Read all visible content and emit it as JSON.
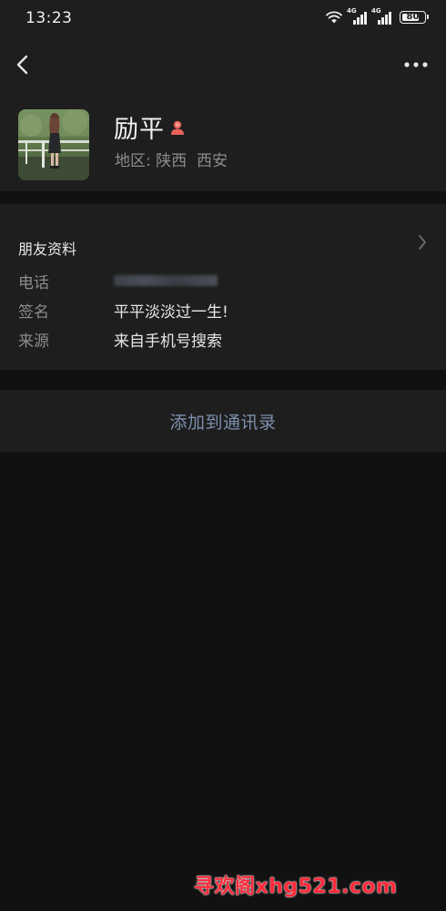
{
  "status_bar": {
    "time": "13:23",
    "network_1": "4G",
    "network_2": "4G",
    "battery": "80",
    "battery_level": 0.8
  },
  "header": {
    "back_icon": "chevron-left-icon",
    "more_icon": "more-horizontal-icon"
  },
  "profile": {
    "name": "励平",
    "gender_icon": "female-icon",
    "region": "地区: 陕西  西安"
  },
  "friend_info": {
    "title": "朋友资料",
    "rows": [
      {
        "key": "电话",
        "value": ""
      },
      {
        "key": "签名",
        "value": "平平淡淡过一生!"
      },
      {
        "key": "来源",
        "value": "来自手机号搜索"
      }
    ]
  },
  "actions": {
    "add_to_contacts": "添加到通讯录"
  },
  "watermark": "寻欢阁xhg521.com",
  "colors": {
    "background": "#111111",
    "card": "#1e1e1e",
    "link": "#7d90ad",
    "female_badge": "#e8625a"
  }
}
